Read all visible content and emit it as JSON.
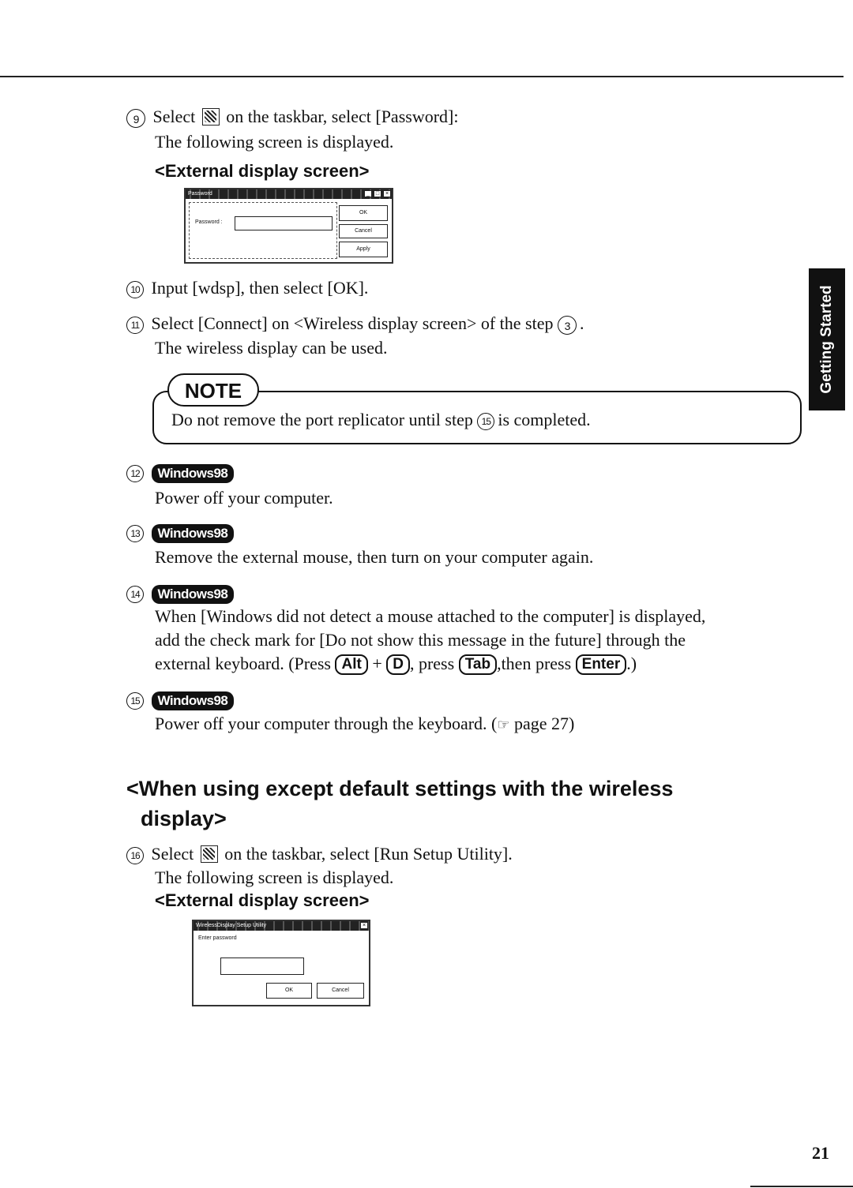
{
  "page": {
    "side_tab": "Getting Started",
    "page_number": "21"
  },
  "step9": {
    "number": "9",
    "text_before_icon": "Select",
    "icon": "wireless-display-taskbar-icon",
    "text_after_icon": "on the taskbar, select [Password]:",
    "line2": "The following screen is displayed.",
    "subheading": "<External display screen>"
  },
  "password_dialog": {
    "title": "Password",
    "title_buttons": [
      "_",
      "□",
      "×"
    ],
    "field_label": "Password :",
    "field_value": "",
    "buttons": [
      "OK",
      "Cancel",
      "Apply"
    ]
  },
  "step10": {
    "number": "10",
    "text": "Input [wdsp], then select [OK]."
  },
  "step11": {
    "number": "11",
    "text_before": "Select [Connect] on <Wireless display screen> of  the step",
    "ref_step": "3",
    "text_after": ".",
    "line2": "The wireless display can be used."
  },
  "note": {
    "badge": "NOTE",
    "text_before": "Do not remove the port replicator until step",
    "ref_step": "15",
    "text_after": "is completed."
  },
  "windows98_badge": "Windows98",
  "step12": {
    "number": "12",
    "text": "Power off your computer."
  },
  "step13": {
    "number": "13",
    "text": "Remove the external mouse, then turn on your computer again."
  },
  "step14": {
    "number": "14",
    "line1": "When [Windows did not detect a mouse attached to the computer] is displayed,",
    "line2": "add the check mark for [Do not show this message in the future] through the",
    "line3_prefix": "external keyboard. (Press",
    "key1": "Alt",
    "plus": "+",
    "key2": "D",
    "mid1": ", press",
    "key3": "Tab",
    "mid2": ",then press",
    "key4": "Enter",
    "suffix": ".)"
  },
  "step15": {
    "number": "15",
    "text_before": "Power off your computer through the keyboard. (",
    "icon": "pointing-hand-icon",
    "text_after": "page 27)"
  },
  "section": {
    "heading_line1": "<When using except default settings with the wireless",
    "heading_line2": "display>"
  },
  "step16": {
    "number": "16",
    "text_before_icon": "Select",
    "icon": "setup-utility-taskbar-icon",
    "text_after_icon": "on the taskbar, select [Run Setup Utility].",
    "line2": "The following screen is displayed.",
    "subheading": "<External display screen>"
  },
  "setup_dialog": {
    "title": "WirelessDisplay Setup Utility",
    "title_buttons": [
      "×"
    ],
    "prompt": "Enter password",
    "field_value": "",
    "buttons": [
      "OK",
      "Cancel"
    ]
  }
}
